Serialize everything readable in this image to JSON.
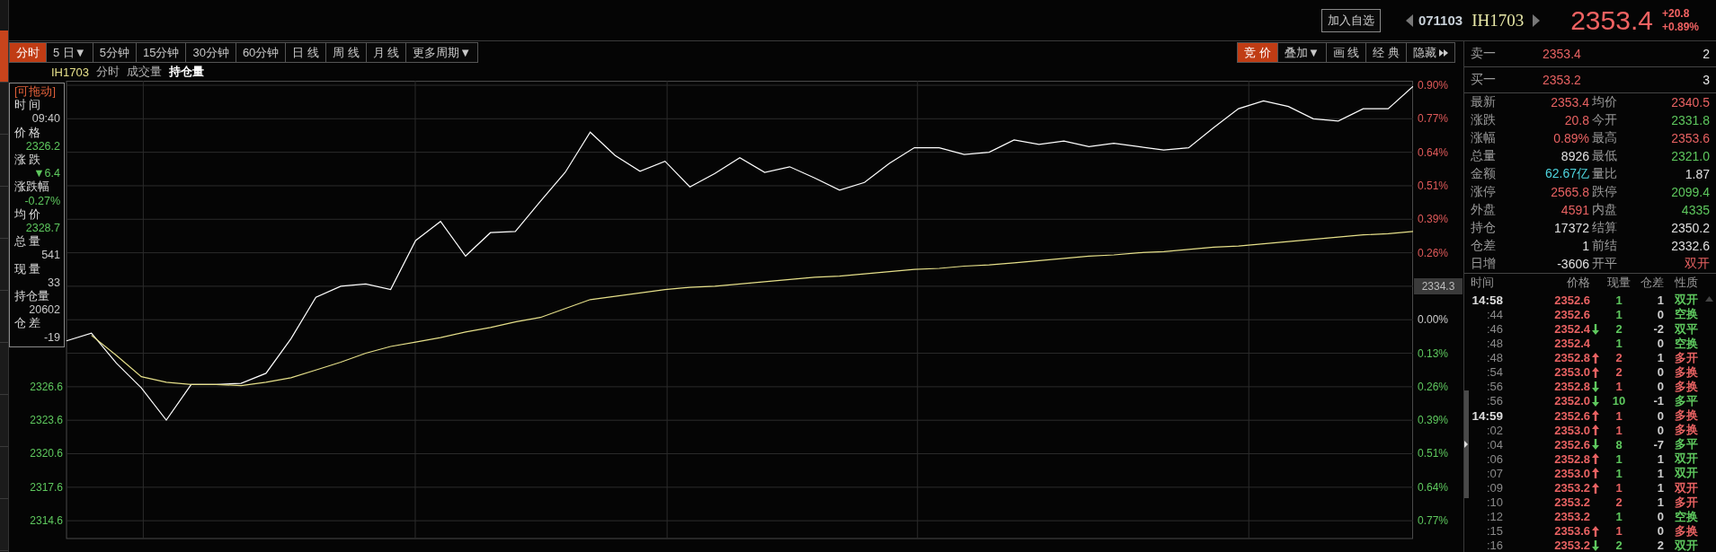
{
  "header": {
    "watch_button": "加入自选",
    "code": "071103",
    "symbol": "IH1703",
    "price": "2353.4",
    "change": "+20.8",
    "change_pct": "+0.89%"
  },
  "side_tabs": [
    {
      "selected": true
    },
    {
      "selected": false
    },
    {
      "selected": false
    },
    {
      "selected": false
    },
    {
      "selected": false
    },
    {
      "selected": false
    },
    {
      "selected": false
    },
    {
      "selected": false
    },
    {
      "selected": false
    },
    {
      "selected": false
    }
  ],
  "periods": [
    {
      "label": "分时",
      "selected": true
    },
    {
      "label": "5 日▼",
      "selected": false
    },
    {
      "label": "5分钟",
      "selected": false
    },
    {
      "label": "15分钟",
      "selected": false
    },
    {
      "label": "30分钟",
      "selected": false
    },
    {
      "label": "60分钟",
      "selected": false
    },
    {
      "label": "日 线",
      "selected": false
    },
    {
      "label": "周 线",
      "selected": false
    },
    {
      "label": "月 线",
      "selected": false
    },
    {
      "label": "更多周期▼",
      "selected": false
    }
  ],
  "tools": [
    {
      "label": "竞 价",
      "selected": true,
      "kind": "plain"
    },
    {
      "label": "叠加▼",
      "selected": false,
      "kind": "plain"
    },
    {
      "label": "画 线",
      "selected": false,
      "kind": "plain"
    },
    {
      "label": "经 典",
      "selected": false,
      "kind": "plain"
    },
    {
      "label": "隐藏",
      "selected": false,
      "kind": "expand"
    }
  ],
  "legend": [
    {
      "label": "IH1703",
      "kind": "symbol",
      "selected": false
    },
    {
      "label": "分时",
      "kind": "indicator",
      "selected": false
    },
    {
      "label": "成交量",
      "kind": "indicator",
      "selected": false
    },
    {
      "label": "持仓量",
      "kind": "indicator",
      "selected": true
    }
  ],
  "chart": {
    "chart_data": {
      "type": "line",
      "grid": true,
      "ylim": [
        2313.0,
        2354.0
      ],
      "yticks": [
        2326.6,
        2323.6,
        2320.6,
        2317.6,
        2314.6
      ],
      "categories": [
        null,
        null,
        null,
        null,
        null,
        null,
        null,
        null,
        null,
        null,
        null,
        null,
        null,
        null,
        null,
        null,
        null,
        null,
        null,
        null,
        null,
        null,
        null,
        null,
        null,
        null,
        null,
        null,
        null,
        null,
        null,
        null,
        null,
        null,
        null,
        null,
        null,
        null,
        null,
        null,
        null,
        null,
        null,
        null,
        null,
        null,
        null,
        null,
        null,
        null,
        null,
        null,
        null,
        null,
        null
      ],
      "series": [
        {
          "color": "#ffffff",
          "values": [
            2330.7,
            2331.4,
            2328.7,
            2326.5,
            2323.6,
            2326.8,
            2326.8,
            2326.9,
            2327.8,
            2330.9,
            2334.6,
            2335.6,
            2335.8,
            2335.3,
            2339.7,
            2341.4,
            2338.3,
            2340.4,
            2340.5,
            2343.2,
            2345.8,
            2349.4,
            2347.3,
            2345.9,
            2346.8,
            2344.5,
            2345.7,
            2347.1,
            2345.8,
            2346.3,
            2345.3,
            2344.2,
            2344.9,
            2346.6,
            2348.0,
            2348.0,
            2347.4,
            2347.6,
            2348.7,
            2348.3,
            2348.6,
            2348.1,
            2348.4,
            2348.1,
            2347.8,
            2348.0,
            2349.8,
            2351.5,
            2352.2,
            2351.7,
            2350.6,
            2350.4,
            2351.5,
            2351.5,
            2353.5
          ]
        },
        {
          "color": "#e6e08a",
          "values": [
            null,
            2331.2,
            2329.4,
            2327.5,
            2327.0,
            2326.8,
            2326.8,
            2326.7,
            2327.0,
            2327.4,
            2328.1,
            2328.8,
            2329.6,
            2330.2,
            2330.6,
            2331.0,
            2331.5,
            2331.9,
            2332.4,
            2332.8,
            2333.6,
            2334.4,
            2334.7,
            2335.0,
            2335.3,
            2335.5,
            2335.6,
            2335.8,
            2336.0,
            2336.2,
            2336.4,
            2336.5,
            2336.7,
            2336.9,
            2337.1,
            2337.2,
            2337.4,
            2337.5,
            2337.7,
            2337.9,
            2338.1,
            2338.3,
            2338.4,
            2338.6,
            2338.7,
            2338.9,
            2339.1,
            2339.2,
            2339.4,
            2339.6,
            2339.8,
            2340.0,
            2340.2,
            2340.3,
            2340.5
          ]
        }
      ]
    },
    "right_axis": [
      {
        "kind": "tick",
        "label": "0.90%",
        "color": "#e05a5a"
      },
      {
        "kind": "tick",
        "label": "0.77%",
        "color": "#e05a5a"
      },
      {
        "kind": "tick",
        "label": "0.64%",
        "color": "#e05a5a"
      },
      {
        "kind": "tick",
        "label": "0.51%",
        "color": "#e05a5a"
      },
      {
        "kind": "tick",
        "label": "0.39%",
        "color": "#e05a5a"
      },
      {
        "kind": "tick",
        "label": "0.26%",
        "color": "#e05a5a"
      },
      {
        "kind": "tag",
        "label": "2334.3"
      },
      {
        "kind": "tick",
        "label": "0.00%",
        "color": "#cccccc"
      },
      {
        "kind": "tick",
        "label": "0.13%",
        "color": "#5ec85e"
      },
      {
        "kind": "tick",
        "label": "0.26%",
        "color": "#5ec85e"
      },
      {
        "kind": "tick",
        "label": "0.39%",
        "color": "#5ec85e"
      },
      {
        "kind": "tick",
        "label": "0.51%",
        "color": "#5ec85e"
      },
      {
        "kind": "tick",
        "label": "0.64%",
        "color": "#5ec85e"
      },
      {
        "kind": "tick",
        "label": "0.77%",
        "color": "#5ec85e"
      }
    ]
  },
  "tooltip": {
    "title": "[可拖动]",
    "rows": [
      {
        "label": "时 间",
        "value": "09:40",
        "color": "#c8c8c8"
      },
      {
        "label": "价 格",
        "value": "2326.2",
        "color": "#5ec85e"
      },
      {
        "label": "涨 跌",
        "value": "▼6.4",
        "color": "#5ec85e"
      },
      {
        "label": "涨跌幅",
        "value": "-0.27%",
        "color": "#5ec85e"
      },
      {
        "label": "均 价",
        "value": "2328.7",
        "color": "#5ec85e"
      },
      {
        "label": "总 量",
        "value": "541",
        "color": "#c8c8c8"
      },
      {
        "label": "现 量",
        "value": "33",
        "color": "#c8c8c8"
      },
      {
        "label": "持仓量",
        "value": "20602",
        "color": "#c8c8c8"
      },
      {
        "label": "仓 差",
        "value": "-19",
        "color": "#c8c8c8"
      }
    ]
  },
  "order_book": [
    {
      "label": "卖一",
      "price": "2353.4",
      "volume": "2"
    },
    {
      "label": "买一",
      "price": "2353.2",
      "volume": "3"
    }
  ],
  "stats": [
    {
      "label": "最新",
      "value": "2353.4",
      "color": "#e86262"
    },
    {
      "label": "均价",
      "value": "2340.5",
      "color": "#e86262"
    },
    {
      "label": "涨跌",
      "value": "20.8",
      "color": "#e86262"
    },
    {
      "label": "今开",
      "value": "2331.8",
      "color": "#5ec85e"
    },
    {
      "label": "涨幅",
      "value": "0.89%",
      "color": "#e86262"
    },
    {
      "label": "最高",
      "value": "2353.6",
      "color": "#e86262"
    },
    {
      "label": "总量",
      "value": "8926",
      "color": "#e0e0e0"
    },
    {
      "label": "最低",
      "value": "2321.0",
      "color": "#5ec85e"
    },
    {
      "label": "金额",
      "value": "62.67亿",
      "color": "#4fd6e0"
    },
    {
      "label": "量比",
      "value": "1.87",
      "color": "#e0e0e0"
    },
    {
      "label": "涨停",
      "value": "2565.8",
      "color": "#e86262"
    },
    {
      "label": "跌停",
      "value": "2099.4",
      "color": "#5ec85e"
    },
    {
      "label": "外盘",
      "value": "4591",
      "color": "#e86262"
    },
    {
      "label": "内盘",
      "value": "4335",
      "color": "#5ec85e"
    },
    {
      "label": "持仓",
      "value": "17372",
      "color": "#e0e0e0"
    },
    {
      "label": "结算",
      "value": "2350.2",
      "color": "#e0e0e0"
    },
    {
      "label": "仓差",
      "value": "1",
      "color": "#e0e0e0"
    },
    {
      "label": "前结",
      "value": "2332.6",
      "color": "#e0e0e0"
    },
    {
      "label": "日增",
      "value": "-3606",
      "color": "#e0e0e0"
    },
    {
      "label": "开平",
      "value": "双开",
      "color": "#e86262"
    }
  ],
  "trades": {
    "columns": [
      "时间",
      "价格",
      "现量",
      "仓差",
      "性质"
    ],
    "rows": [
      {
        "time": "14:58",
        "kind": "minute",
        "price": "2352.6",
        "rising": false,
        "falling": false,
        "volume": "1",
        "diff": "1",
        "nature": "双开",
        "color": "#5ec85e"
      },
      {
        "time": ":44",
        "kind": "second",
        "price": "2352.6",
        "rising": false,
        "falling": false,
        "volume": "1",
        "diff": "0",
        "nature": "空换",
        "color": "#5ec85e"
      },
      {
        "time": ":46",
        "kind": "second",
        "price": "2352.4",
        "rising": false,
        "falling": true,
        "volume": "2",
        "diff": "-2",
        "nature": "双平",
        "color": "#5ec85e"
      },
      {
        "time": ":48",
        "kind": "second",
        "price": "2352.4",
        "rising": false,
        "falling": false,
        "volume": "1",
        "diff": "0",
        "nature": "空换",
        "color": "#5ec85e"
      },
      {
        "time": ":48",
        "kind": "second",
        "price": "2352.8",
        "rising": true,
        "falling": false,
        "volume": "2",
        "diff": "1",
        "nature": "多开",
        "color": "#e86262"
      },
      {
        "time": ":54",
        "kind": "second",
        "price": "2353.0",
        "rising": true,
        "falling": false,
        "volume": "2",
        "diff": "0",
        "nature": "多换",
        "color": "#e86262"
      },
      {
        "time": ":56",
        "kind": "second",
        "price": "2352.8",
        "rising": false,
        "falling": true,
        "volume": "1",
        "diff": "0",
        "nature": "多换",
        "color": "#e86262"
      },
      {
        "time": ":56",
        "kind": "second",
        "price": "2352.0",
        "rising": false,
        "falling": true,
        "volume": "10",
        "diff": "-1",
        "nature": "多平",
        "color": "#5ec85e"
      },
      {
        "time": "14:59",
        "kind": "minute",
        "price": "2352.6",
        "rising": true,
        "falling": false,
        "volume": "1",
        "diff": "0",
        "nature": "多换",
        "color": "#e86262"
      },
      {
        "time": ":02",
        "kind": "second",
        "price": "2353.0",
        "rising": true,
        "falling": false,
        "volume": "1",
        "diff": "0",
        "nature": "多换",
        "color": "#e86262"
      },
      {
        "time": ":04",
        "kind": "second",
        "price": "2352.6",
        "rising": false,
        "falling": true,
        "volume": "8",
        "diff": "-7",
        "nature": "多平",
        "color": "#5ec85e"
      },
      {
        "time": ":06",
        "kind": "second",
        "price": "2352.8",
        "rising": true,
        "falling": false,
        "volume": "1",
        "diff": "1",
        "nature": "双开",
        "color": "#5ec85e"
      },
      {
        "time": ":07",
        "kind": "second",
        "price": "2353.0",
        "rising": true,
        "falling": false,
        "volume": "1",
        "diff": "1",
        "nature": "双开",
        "color": "#5ec85e"
      },
      {
        "time": ":09",
        "kind": "second",
        "price": "2353.2",
        "rising": true,
        "falling": false,
        "volume": "1",
        "diff": "1",
        "nature": "双开",
        "color": "#e86262"
      },
      {
        "time": ":10",
        "kind": "second",
        "price": "2353.2",
        "rising": false,
        "falling": false,
        "volume": "2",
        "diff": "1",
        "nature": "多开",
        "color": "#e86262"
      },
      {
        "time": ":12",
        "kind": "second",
        "price": "2353.2",
        "rising": false,
        "falling": false,
        "volume": "1",
        "diff": "0",
        "nature": "空换",
        "color": "#5ec85e"
      },
      {
        "time": ":15",
        "kind": "second",
        "price": "2353.6",
        "rising": true,
        "falling": false,
        "volume": "1",
        "diff": "0",
        "nature": "多换",
        "color": "#e86262"
      },
      {
        "time": ":16",
        "kind": "second",
        "price": "2353.2",
        "rising": false,
        "falling": true,
        "volume": "2",
        "diff": "2",
        "nature": "双开",
        "color": "#5ec85e"
      }
    ]
  }
}
